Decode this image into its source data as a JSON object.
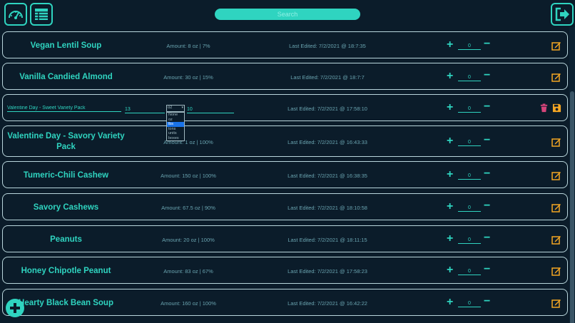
{
  "header": {
    "search_placeholder": "Search",
    "icons": [
      "dashboard-gauge-icon",
      "table-grid-icon",
      "logout-icon"
    ]
  },
  "rows": [
    {
      "name": "Vegan Lentil Soup",
      "amount": "Amount: 8 oz | 7%",
      "edited": "Last Edited: 7/2/2021 @ 18:7:35",
      "qty": "0"
    },
    {
      "name": "Vanilla Candied Almond",
      "amount": "Amount: 30 oz | 15%",
      "edited": "Last Edited: 7/2/2021 @ 18:7:7",
      "qty": "0"
    },
    {
      "name": "Valentine Day - Sweet Variety Pack",
      "amount_value": "13",
      "unit": "oz",
      "percent_value": "10",
      "edited": "Last Edited: 7/2/2021 @ 17:58:10",
      "qty": "0",
      "editing": true
    },
    {
      "name": "Valentine Day - Savory Variety Pack",
      "amount": "Amount: 1 oz | 100%",
      "edited": "Last Edited: 7/2/2021 @ 16:43:33",
      "qty": "0"
    },
    {
      "name": "Tumeric-Chili Cashew",
      "amount": "Amount: 150 oz | 100%",
      "edited": "Last Edited: 7/2/2021 @ 16:38:35",
      "qty": "0"
    },
    {
      "name": "Savory Cashews",
      "amount": "Amount: 67.5 oz | 90%",
      "edited": "Last Edited: 7/2/2021 @ 18:10:58",
      "qty": "0"
    },
    {
      "name": "Peanuts",
      "amount": "Amount: 20 oz | 100%",
      "edited": "Last Edited: 7/2/2021 @ 18:11:15",
      "qty": "0"
    },
    {
      "name": "Honey Chipotle Peanut",
      "amount": "Amount: 83 oz | 67%",
      "edited": "Last Edited: 7/2/2021 @ 17:58:23",
      "qty": "0"
    },
    {
      "name": "Hearty Black Bean Soup",
      "amount": "Amount: 160 oz | 100%",
      "edited": "Last Edited: 7/2/2021 @ 16:42:22",
      "qty": "0"
    }
  ],
  "unit_options": [
    "None",
    "oz",
    "lbs",
    "tons",
    "units",
    "boxes"
  ],
  "unit_selected": "lbs",
  "colors": {
    "accent": "#2fd4c0",
    "background": "#0b1c2a",
    "edit_icon": "#f5a623",
    "delete_icon": "#d6457a"
  }
}
